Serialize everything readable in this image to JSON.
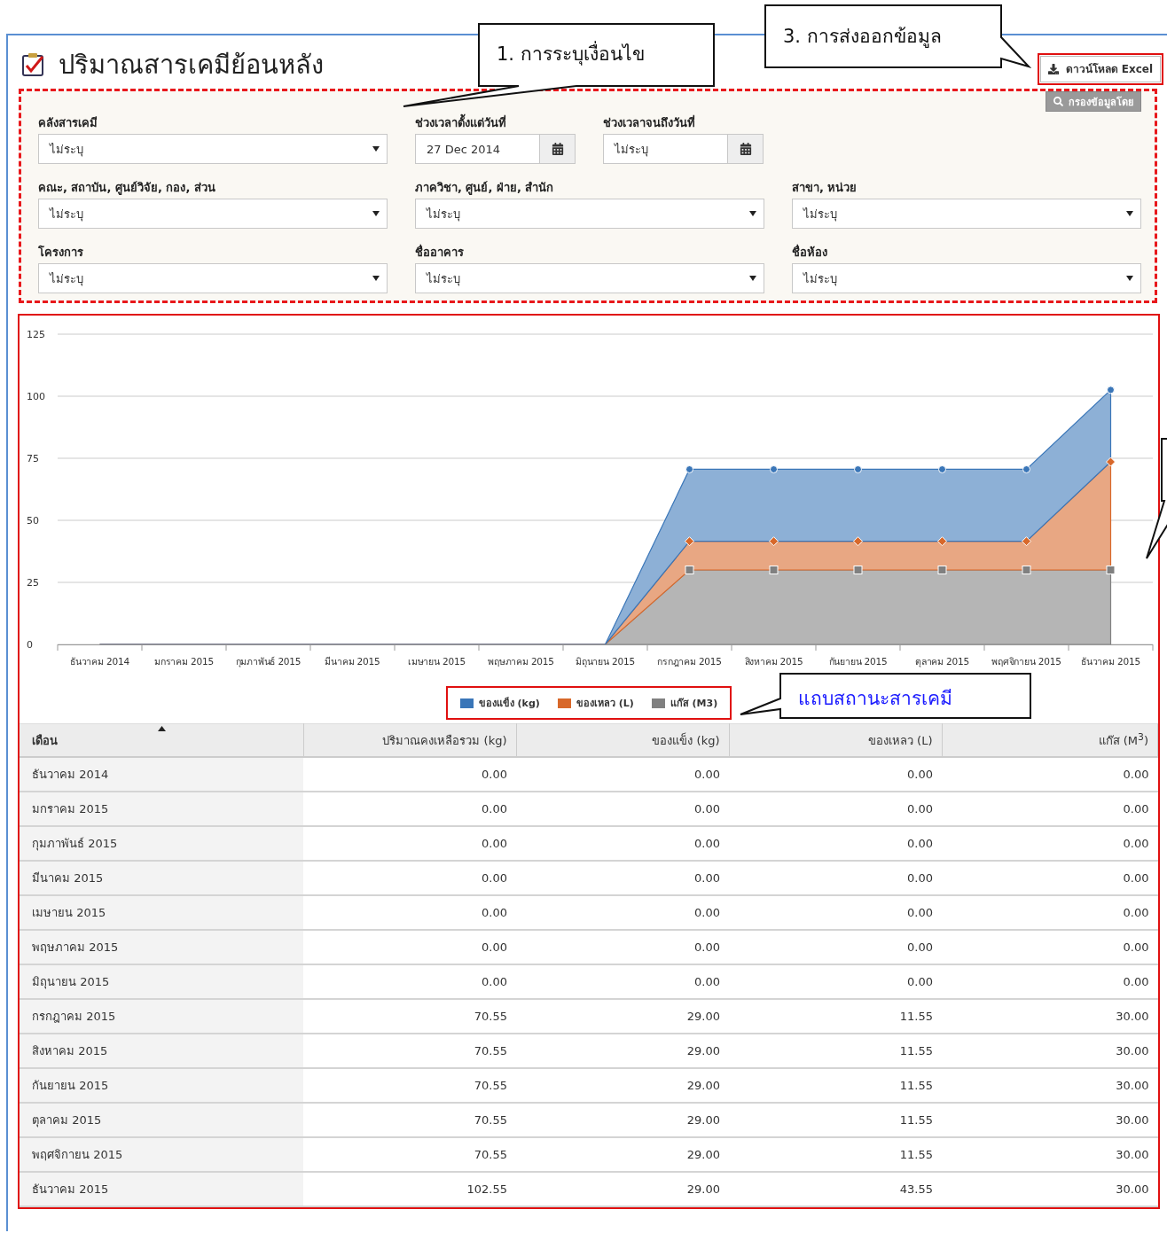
{
  "page": {
    "title": "ปริมาณสารเคมีย้อนหลัง"
  },
  "export_button": {
    "label": "ดาวน์โหลด Excel"
  },
  "filter_panel": {
    "button": "กรองข้อมูลโดย",
    "rows": [
      [
        {
          "kind": "select",
          "label": "คลังสารเคมี",
          "value": "ไม่ระบุ"
        },
        {
          "kind": "date",
          "label": "ช่วงเวลาตั้งแต่วันที่",
          "value": "27 Dec 2014"
        },
        {
          "kind": "date",
          "label": "ช่วงเวลาจนถึงวันที่",
          "value": "ไม่ระบุ"
        }
      ],
      [
        {
          "kind": "select",
          "label": "คณะ, สถาบัน, ศูนย์วิจัย, กอง, ส่วน",
          "value": "ไม่ระบุ"
        },
        {
          "kind": "select",
          "label": "ภาควิชา, ศูนย์, ฝ่าย, สำนัก",
          "value": "ไม่ระบุ"
        },
        {
          "kind": "select",
          "label": "สาขา, หน่วย",
          "value": "ไม่ระบุ"
        }
      ],
      [
        {
          "kind": "select",
          "label": "โครงการ",
          "value": "ไม่ระบุ"
        },
        {
          "kind": "select",
          "label": "ชื่ออาคาร",
          "value": "ไม่ระบุ"
        },
        {
          "kind": "select",
          "label": "ชื่อห้อง",
          "value": "ไม่ระบุ"
        }
      ]
    ]
  },
  "chart": {
    "chart_data": {
      "type": "area",
      "stacked": true,
      "grid": true,
      "legend": true,
      "categories": [
        "ธันวาคม 2014",
        "มกราคม 2015",
        "กุมภาพันธ์ 2015",
        "มีนาคม 2015",
        "เมษายน 2015",
        "พฤษภาคม 2015",
        "มิถุนายน 2015",
        "กรกฎาคม 2015",
        "สิงหาคม 2015",
        "กันยายน 2015",
        "ตุลาคม 2015",
        "พฤศจิกายน 2015",
        "ธันวาคม 2015"
      ],
      "ylim": [
        0,
        125
      ],
      "yticks": [
        0,
        25,
        50,
        75,
        100,
        125
      ],
      "series": [
        {
          "name": "ของแข็ง (kg)",
          "color": "#3a76b8",
          "values": [
            0,
            0,
            0,
            0,
            0,
            0,
            0,
            29,
            29,
            29,
            29,
            29,
            29
          ]
        },
        {
          "name": "ของเหลว (L)",
          "color": "#d8682a",
          "values": [
            0,
            0,
            0,
            0,
            0,
            0,
            0,
            11.55,
            11.55,
            11.55,
            11.55,
            11.55,
            43.55
          ]
        },
        {
          "name": "แก๊ส (M3)",
          "color": "#808080",
          "values": [
            0,
            0,
            0,
            0,
            0,
            0,
            0,
            30,
            30,
            30,
            30,
            30,
            30
          ]
        }
      ]
    }
  },
  "table": {
    "columns": [
      {
        "label": "เดือน",
        "sorted": true
      },
      {
        "label": "ปริมาณคงเหลือรวม (kg)",
        "sorted": false
      },
      {
        "label": "ของแข็ง (kg)",
        "sorted": false
      },
      {
        "label": "ของเหลว (L)",
        "sorted": false
      },
      {
        "label": "แก๊ส (M$^{3}$)",
        "sorted": false
      }
    ],
    "rows": [
      [
        "ธันวาคม 2014",
        "0.00",
        "0.00",
        "0.00",
        "0.00"
      ],
      [
        "มกราคม 2015",
        "0.00",
        "0.00",
        "0.00",
        "0.00"
      ],
      [
        "กุมภาพันธ์ 2015",
        "0.00",
        "0.00",
        "0.00",
        "0.00"
      ],
      [
        "มีนาคม 2015",
        "0.00",
        "0.00",
        "0.00",
        "0.00"
      ],
      [
        "เมษายน 2015",
        "0.00",
        "0.00",
        "0.00",
        "0.00"
      ],
      [
        "พฤษภาคม 2015",
        "0.00",
        "0.00",
        "0.00",
        "0.00"
      ],
      [
        "มิถุนายน 2015",
        "0.00",
        "0.00",
        "0.00",
        "0.00"
      ],
      [
        "กรกฎาคม 2015",
        "70.55",
        "29.00",
        "11.55",
        "30.00"
      ],
      [
        "สิงหาคม 2015",
        "70.55",
        "29.00",
        "11.55",
        "30.00"
      ],
      [
        "กันยายน 2015",
        "70.55",
        "29.00",
        "11.55",
        "30.00"
      ],
      [
        "ตุลาคม 2015",
        "70.55",
        "29.00",
        "11.55",
        "30.00"
      ],
      [
        "พฤศจิกายน 2015",
        "70.55",
        "29.00",
        "11.55",
        "30.00"
      ],
      [
        "ธันวาคม 2015",
        "102.55",
        "29.00",
        "43.55",
        "30.00"
      ]
    ]
  },
  "callouts": [
    {
      "text": "1. การระบุเงื่อนไข"
    },
    {
      "text": "3. การส่งออกข้อมูล"
    },
    {
      "text": "แถบสถานะสารเคมี"
    }
  ]
}
